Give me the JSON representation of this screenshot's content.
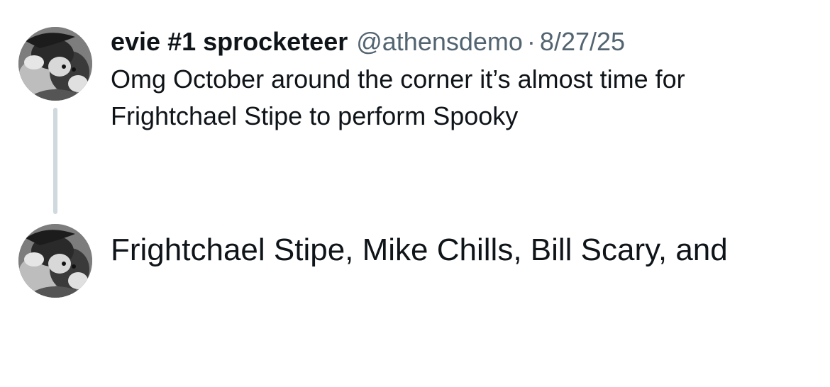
{
  "colors": {
    "primary_text": "#0f1419",
    "secondary_text": "#536471",
    "thread_line": "#cfd9de",
    "background": "#ffffff"
  },
  "tweets": [
    {
      "avatar_icon": "profile-photo-icon",
      "display_name": "evie #1 sprocketeer",
      "handle": "@athensdemo",
      "separator": "·",
      "date": "8/27/25",
      "text": "Omg October around the corner it’s almost time for Frightchael Stipe to perform Spooky"
    },
    {
      "avatar_icon": "profile-photo-icon",
      "text": "Frightchael Stipe, Mike Chills, Bill Scary, and"
    }
  ]
}
